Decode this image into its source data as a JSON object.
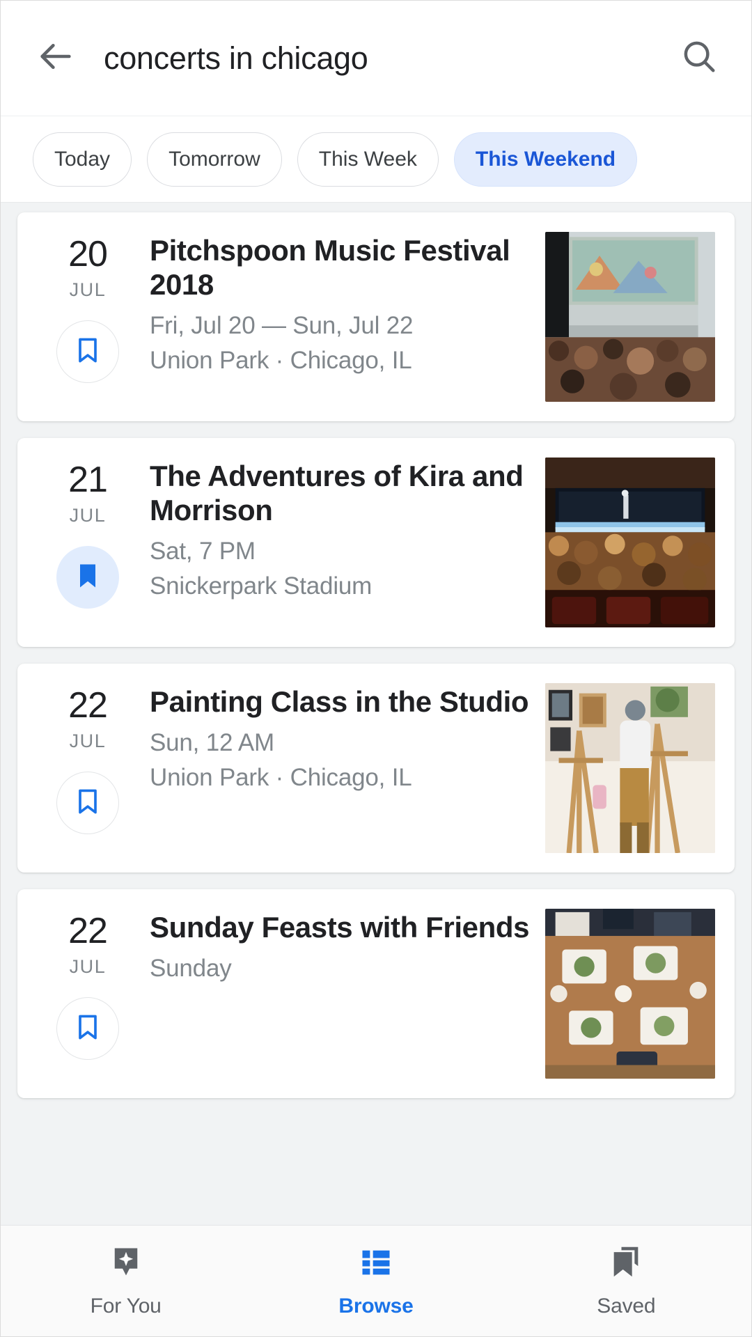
{
  "search": {
    "query": "concerts in chicago",
    "back_icon": "back-arrow-icon",
    "search_icon": "search-icon"
  },
  "filters": {
    "chips": [
      {
        "label": "Today",
        "active": false
      },
      {
        "label": "Tomorrow",
        "active": false
      },
      {
        "label": "This Week",
        "active": false
      },
      {
        "label": "This Weekend",
        "active": true
      }
    ],
    "active_color": "#1a56d6",
    "active_background": "#e3ecfd"
  },
  "events": [
    {
      "day": "20",
      "month": "JUL",
      "title": "Pitchspoon Music Festival 2018",
      "datetime": "Fri, Jul 20 — Sun, Jul 22",
      "venue": "Union Park · Chicago, IL",
      "saved": false,
      "bookmark_icon": "bookmark-outline-icon",
      "thumbnail": "music-festival-crowd-stage-photo"
    },
    {
      "day": "21",
      "month": "JUL",
      "title": "The Adventures of Kira and Morrison",
      "datetime": "Sat, 7 PM",
      "venue": "Snickerpark Stadium",
      "saved": true,
      "bookmark_icon": "bookmark-filled-icon",
      "thumbnail": "theatre-audience-stage-photo"
    },
    {
      "day": "22",
      "month": "JUL",
      "title": "Painting Class in the Studio",
      "datetime": "Sun, 12 AM",
      "venue": "Union Park · Chicago, IL",
      "saved": false,
      "bookmark_icon": "bookmark-outline-icon",
      "thumbnail": "painter-easel-studio-photo"
    },
    {
      "day": "22",
      "month": "JUL",
      "title": "Sunday Feasts with Friends",
      "datetime": "Sunday",
      "venue": "",
      "saved": false,
      "bookmark_icon": "bookmark-outline-icon",
      "thumbnail": "dinner-table-food-overhead-photo"
    }
  ],
  "bottom_nav": {
    "items": [
      {
        "label": "For You",
        "icon": "for-you-sparkle-icon",
        "active": false
      },
      {
        "label": "Browse",
        "icon": "browse-list-icon",
        "active": true
      },
      {
        "label": "Saved",
        "icon": "saved-bookmarks-icon",
        "active": false
      }
    ],
    "active_color": "#1a73e8",
    "inactive_color": "#5f6368"
  }
}
